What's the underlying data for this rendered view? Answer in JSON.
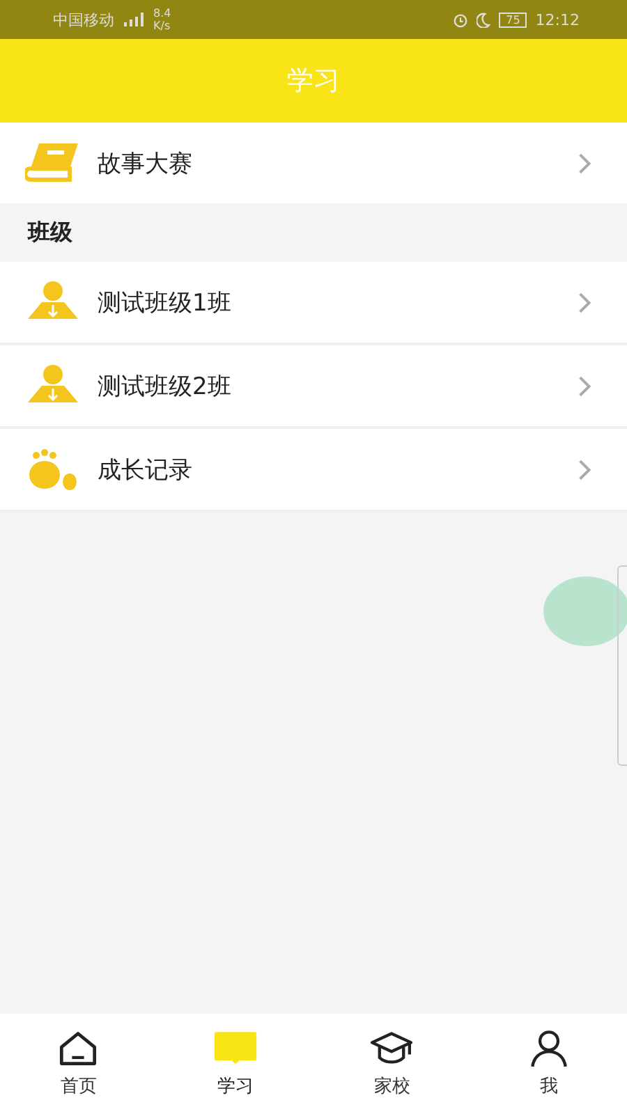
{
  "status_bar": {
    "carrier": "中国移动",
    "speed": "8.4 K/s",
    "battery": "75",
    "time": "12:12"
  },
  "header": {
    "title": "学习"
  },
  "top_items": [
    {
      "label": "故事大赛",
      "kind": "book"
    }
  ],
  "section": {
    "title": "班级"
  },
  "class_items": [
    {
      "label": "测试班级1班",
      "kind": "person"
    },
    {
      "label": "测试班级2班",
      "kind": "person"
    },
    {
      "label": "成长记录",
      "kind": "foot"
    }
  ],
  "tabs": [
    {
      "label": "首页",
      "kind": "home",
      "selected": false
    },
    {
      "label": "学习",
      "kind": "study",
      "selected": true
    },
    {
      "label": "家校",
      "kind": "school",
      "selected": false
    },
    {
      "label": "我",
      "kind": "me",
      "selected": false
    }
  ]
}
